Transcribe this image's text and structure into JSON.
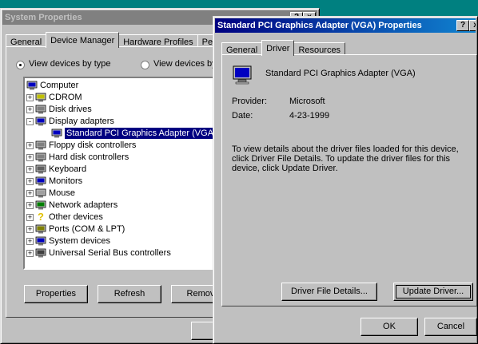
{
  "sysprops": {
    "title": "System Properties",
    "tabs": [
      "General",
      "Device Manager",
      "Hardware Profiles",
      "Perf"
    ],
    "view_by_type": "View devices by type",
    "view_by_conn": "View devices by",
    "tree": [
      {
        "label": "Computer",
        "icon": "computer-icon",
        "level": 0,
        "exp": ""
      },
      {
        "label": "CDROM",
        "icon": "cdrom-icon",
        "level": 1,
        "exp": "+"
      },
      {
        "label": "Disk drives",
        "icon": "disk-drive-icon",
        "level": 1,
        "exp": "+"
      },
      {
        "label": "Display adapters",
        "icon": "display-adapter-icon",
        "level": 1,
        "exp": "-"
      },
      {
        "label": "Standard PCI Graphics Adapter (VGA)",
        "icon": "display-adapter-icon",
        "level": 2,
        "exp": "",
        "selected": true
      },
      {
        "label": "Floppy disk controllers",
        "icon": "controller-icon",
        "level": 1,
        "exp": "+"
      },
      {
        "label": "Hard disk controllers",
        "icon": "controller-icon",
        "level": 1,
        "exp": "+"
      },
      {
        "label": "Keyboard",
        "icon": "keyboard-icon",
        "level": 1,
        "exp": "+"
      },
      {
        "label": "Monitors",
        "icon": "monitor-icon",
        "level": 1,
        "exp": "+"
      },
      {
        "label": "Mouse",
        "icon": "mouse-icon",
        "level": 1,
        "exp": "+"
      },
      {
        "label": "Network adapters",
        "icon": "network-adapter-icon",
        "level": 1,
        "exp": "+"
      },
      {
        "label": "Other devices",
        "icon": "question-mark-icon",
        "level": 1,
        "exp": "+"
      },
      {
        "label": "Ports (COM & LPT)",
        "icon": "port-icon",
        "level": 1,
        "exp": "+"
      },
      {
        "label": "System devices",
        "icon": "system-device-icon",
        "level": 1,
        "exp": "+"
      },
      {
        "label": "Universal Serial Bus controllers",
        "icon": "usb-icon",
        "level": 1,
        "exp": "+"
      }
    ],
    "buttons": {
      "properties": "Properties",
      "refresh": "Refresh",
      "remove": "Remove"
    },
    "title_buttons": {
      "help": "?",
      "close": "x"
    }
  },
  "adapter": {
    "title": "Standard PCI Graphics Adapter (VGA) Properties",
    "tabs": [
      "General",
      "Driver",
      "Resources"
    ],
    "device_name": "Standard PCI Graphics Adapter (VGA)",
    "provider_label": "Provider:",
    "provider_value": "Microsoft",
    "date_label": "Date:",
    "date_value": "4-23-1999",
    "description": "To view details about the driver files loaded for this device, click Driver File Details.  To update the driver files for this device, click Update Driver.",
    "buttons": {
      "driver_details": "Driver File Details...",
      "update_driver": "Update Driver...",
      "ok": "OK",
      "cancel": "Cancel"
    },
    "title_buttons": {
      "help": "?",
      "close": "x"
    }
  }
}
